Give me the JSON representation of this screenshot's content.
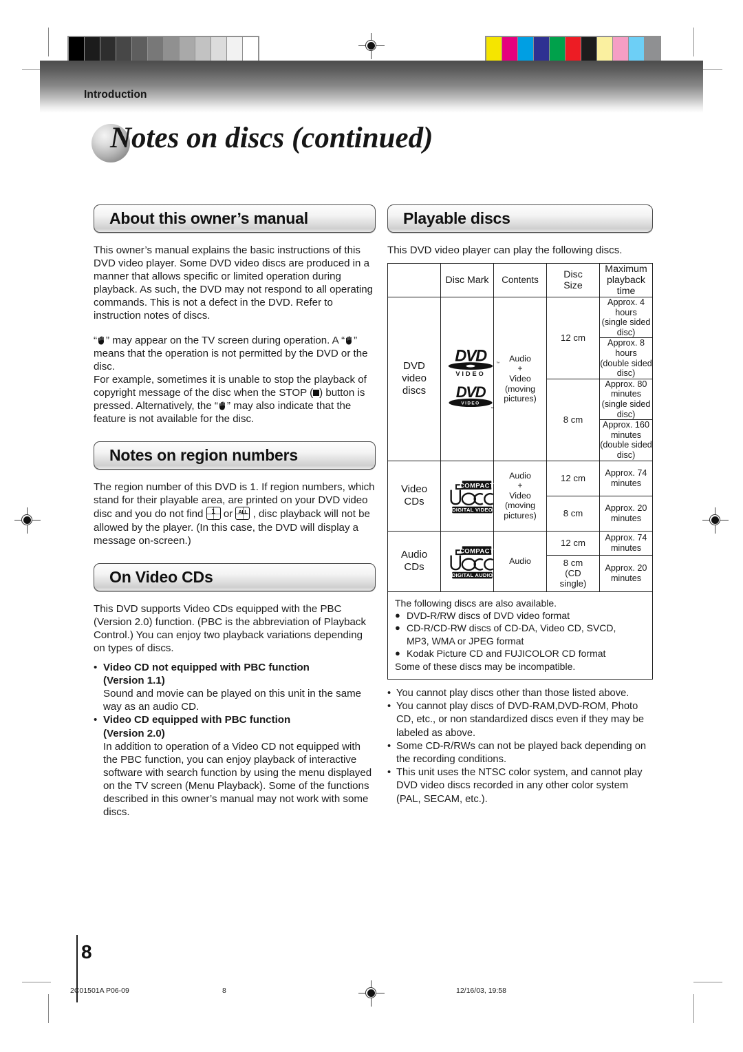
{
  "header": {
    "kicker": "Introduction",
    "title": "Notes on discs (continued)"
  },
  "left_column": {
    "section1": {
      "heading": "About this owner’s manual",
      "para1": "This owner’s manual explains the basic instructions of this DVD video player. Some DVD video discs are produced in a manner that allows specific or limited operation during playback. As such, the DVD may not respond to all operating commands. This is not a defect in the DVD. Refer to instruction notes of discs.",
      "para2_a": "“",
      "para2_b": "” may appear on the TV screen during operation. A “",
      "para2_c": "” means that the operation is not permitted by the DVD or the disc.",
      "para3_a": "For example, sometimes it is unable to stop the playback of copyright message of the disc when the STOP (",
      "para3_b": ") button is pressed. Alternatively, the “",
      "para3_c": "” may also indicate that the feature is not available for the disc."
    },
    "section2": {
      "heading": "Notes on region numbers",
      "para_a": "The region number of this DVD is 1. If region numbers, which stand for their playable area, are printed on your DVD video disc and you do not find ",
      "icon1_label": "1",
      "para_b": " or ",
      "icon2_label": "ALL",
      "para_c": " , disc playback will not be allowed by the player. (In this case, the DVD will display a message on-screen.)"
    },
    "section3": {
      "heading": "On Video CDs",
      "para1": "This DVD supports Video CDs equipped with the PBC (Version 2.0) function. (PBC is the abbreviation of Playback Control.) You can enjoy two playback variations depending on types of discs.",
      "bullets": [
        {
          "mark": "•",
          "title_line1": "Video CD not equipped with PBC function",
          "title_line2": "(Version 1.1)",
          "body": "Sound and movie can be played on this unit in the same way as an audio CD."
        },
        {
          "mark": "•",
          "title_line1": "Video CD equipped with PBC function",
          "title_line2": "(Version 2.0)",
          "body": "In addition to operation of a Video CD not equipped with the PBC function, you can enjoy playback of interactive software with search function by using the menu displayed on the TV screen (Menu Playback). Some of the functions described in this owner’s manual may not work with some discs."
        }
      ]
    }
  },
  "right_column": {
    "heading": "Playable discs",
    "intro": "This DVD video player can play the following discs.",
    "table": {
      "headers": {
        "blank": "",
        "disc_mark": "Disc Mark",
        "contents": "Contents",
        "disc_size": "Disc\nSize",
        "disc_size_l1": "Disc",
        "disc_size_l2": "Size",
        "maximum_l1": "Maximum",
        "maximum_l2": "playback time"
      },
      "rows": [
        {
          "category_l1": "DVD",
          "category_l2": "video",
          "category_l3": "discs",
          "mark": "dvd-video-logo",
          "mark2": "dvd-video-logo-alt",
          "contents_lines": [
            "Audio",
            "+",
            "Video",
            "(moving",
            "pictures)"
          ],
          "sizes": [
            {
              "size": "12 cm",
              "times": [
                {
                  "l1": "Approx. 4 hours",
                  "l2": "(single sided disc)"
                },
                {
                  "l1": "Approx. 8 hours",
                  "l2": "(double sided disc)"
                }
              ]
            },
            {
              "size": "8 cm",
              "times": [
                {
                  "l1": "Approx. 80 minutes",
                  "l2": "(single sided disc)"
                },
                {
                  "l1": "Approx. 160 minutes",
                  "l2": "(double sided disc)"
                }
              ]
            }
          ]
        },
        {
          "category_l1": "Video",
          "category_l2": "CDs",
          "mark": "compact-disc-digital-video-logo",
          "mark_top": "COMPACT",
          "mark_mid": "disc",
          "mark_bot": "DIGITAL VIDEO",
          "contents_lines": [
            "Audio",
            "+",
            "Video",
            "(moving",
            "pictures)"
          ],
          "sizes": [
            {
              "size": "12 cm",
              "times": [
                {
                  "l1": "Approx. 74 minutes",
                  "l2": ""
                }
              ]
            },
            {
              "size": "8 cm",
              "times": [
                {
                  "l1": "Approx. 20 minutes",
                  "l2": ""
                }
              ]
            }
          ]
        },
        {
          "category_l1": "Audio",
          "category_l2": "CDs",
          "mark": "compact-disc-digital-audio-logo",
          "mark_top": "COMPACT",
          "mark_mid": "disc",
          "mark_bot": "DIGITAL AUDIO",
          "contents_lines": [
            "Audio"
          ],
          "sizes": [
            {
              "size": "12 cm",
              "times": [
                {
                  "l1": "Approx. 74 minutes",
                  "l2": ""
                }
              ]
            },
            {
              "size_l1": "8 cm",
              "size_l2": "(CD",
              "size_l3": "single)",
              "times": [
                {
                  "l1": "Approx. 20 minutes",
                  "l2": ""
                }
              ]
            }
          ]
        }
      ]
    },
    "also_available": {
      "intro": "The following discs are also available.",
      "bullet_mark": "●",
      "items": [
        "DVD-R/RW discs of DVD video format",
        "CD-R/CD-RW discs of CD-DA, Video CD, SVCD,\nMP3, WMA or JPEG format",
        "Kodak Picture CD and FUJICOLOR CD format"
      ],
      "item1": "DVD-R/RW discs of DVD video format",
      "item2_l1": "CD-R/CD-RW discs of CD-DA, Video CD, SVCD,",
      "item2_l2": "MP3, WMA or JPEG format",
      "item3": "Kodak Picture CD and FUJICOLOR CD format",
      "footer": "Some of these discs may be incompatible."
    },
    "notes": {
      "bullet_mark": "•",
      "items": [
        "You cannot play discs other than those listed above.",
        "You cannot play discs of DVD-RAM,DVD-ROM, Photo CD, etc., or non standardized discs even if they may be labeled as above.",
        "Some CD-R/RWs can not be played back depending on the recording conditions.",
        "This unit uses the NTSC color system, and cannot play DVD video discs recorded in any other color system (PAL, SECAM, etc.)."
      ]
    }
  },
  "footer": {
    "page_number": "8",
    "doc_code": "2C01501A P06-09",
    "folio": "8",
    "timestamp": "12/16/03, 19:58"
  },
  "print_marks": {
    "gray_bars": [
      "#000000",
      "#1c1c1c",
      "#2e2e2e",
      "#474747",
      "#5e5e5e",
      "#787878",
      "#909090",
      "#a9a9a9",
      "#c2c2c2",
      "#dcdcdc",
      "#f2f2f2",
      "#ffffff"
    ],
    "color_bars": [
      "#f5e500",
      "#e6007e",
      "#009fe3",
      "#2e3192",
      "#00a14b",
      "#ed1c24",
      "#1c1c1c",
      "#faf0a0",
      "#f59ec4",
      "#6dcff6",
      "#8f9092"
    ]
  }
}
